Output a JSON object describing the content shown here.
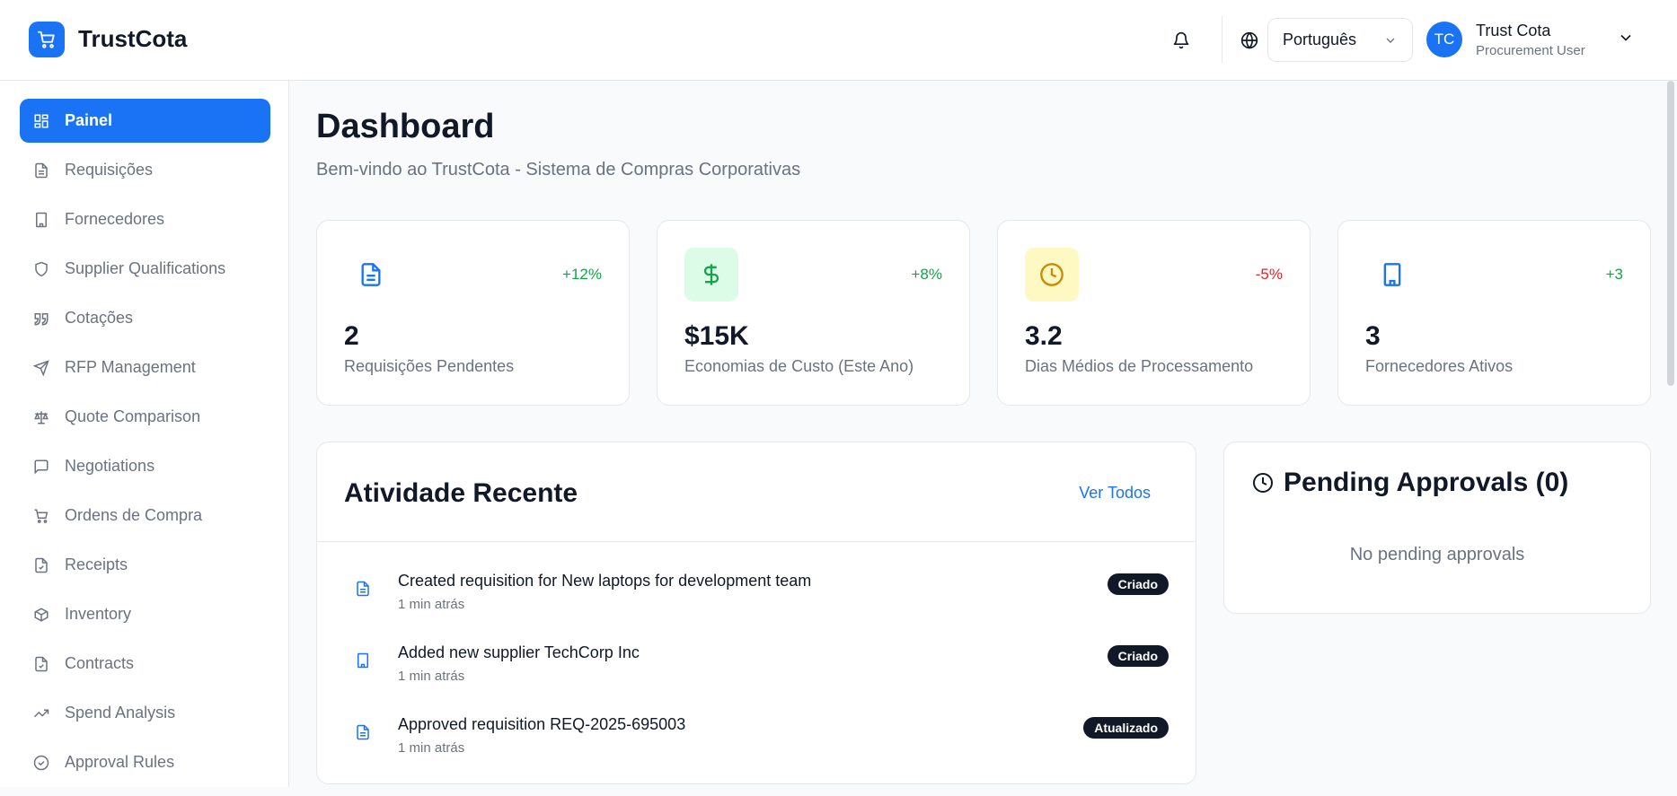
{
  "app": {
    "brand": "TrustCota"
  },
  "header": {
    "language": "Português",
    "user": {
      "initials": "TC",
      "name": "Trust Cota",
      "role": "Procurement User"
    }
  },
  "sidebar": {
    "items": [
      {
        "label": "Painel",
        "icon": "grid-icon",
        "active": true
      },
      {
        "label": "Requisições",
        "icon": "file-icon"
      },
      {
        "label": "Fornecedores",
        "icon": "building-icon"
      },
      {
        "label": "Supplier Qualifications",
        "icon": "shield-icon"
      },
      {
        "label": "Cotações",
        "icon": "quote-icon"
      },
      {
        "label": "RFP Management",
        "icon": "send-icon"
      },
      {
        "label": "Quote Comparison",
        "icon": "scale-icon"
      },
      {
        "label": "Negotiations",
        "icon": "message-icon"
      },
      {
        "label": "Ordens de Compra",
        "icon": "cart-icon"
      },
      {
        "label": "Receipts",
        "icon": "file-check-icon"
      },
      {
        "label": "Inventory",
        "icon": "package-icon"
      },
      {
        "label": "Contracts",
        "icon": "file-check-icon"
      },
      {
        "label": "Spend Analysis",
        "icon": "trending-up-icon"
      },
      {
        "label": "Approval Rules",
        "icon": "check-circle-icon"
      }
    ]
  },
  "main": {
    "title": "Dashboard",
    "subtitle": "Bem-vindo ao TrustCota - Sistema de Compras Corporativas",
    "stats": [
      {
        "value": "2",
        "label": "Requisições Pendentes",
        "change": "+12%",
        "change_color": "#16a34a",
        "icon": "file-icon",
        "icon_color": "#1a73f5",
        "icon_bg": "transparent"
      },
      {
        "value": "$15K",
        "label": "Economias de Custo (Este Ano)",
        "change": "+8%",
        "change_color": "#16a34a",
        "icon": "dollar-icon",
        "icon_color": "#16a34a",
        "icon_bg": "#dcfce7"
      },
      {
        "value": "3.2",
        "label": "Dias Médios de Processamento",
        "change": "-5%",
        "change_color": "#dc2626",
        "icon": "clock-icon",
        "icon_color": "#ca8a04",
        "icon_bg": "#fef9c3"
      },
      {
        "value": "3",
        "label": "Fornecedores Ativos",
        "change": "+3",
        "change_color": "#16a34a",
        "icon": "building-icon",
        "icon_color": "#1a73f5",
        "icon_bg": "transparent"
      }
    ],
    "activity": {
      "title": "Atividade Recente",
      "link": "Ver Todos",
      "items": [
        {
          "text": "Created requisition for New laptops for development team",
          "time": "1 min atrás",
          "badge": "Criado",
          "icon": "file-icon"
        },
        {
          "text": "Added new supplier TechCorp Inc",
          "time": "1 min atrás",
          "badge": "Criado",
          "icon": "building-icon"
        },
        {
          "text": "Approved requisition REQ-2025-695003",
          "time": "1 min atrás",
          "badge": "Atualizado",
          "icon": "file-icon"
        }
      ]
    },
    "pending": {
      "title": "Pending Approvals (0)",
      "empty": "No pending approvals"
    }
  },
  "colors": {
    "accent": "#1a73f5",
    "text": "#111827",
    "muted": "#6b7280",
    "border": "#e5e7eb"
  }
}
